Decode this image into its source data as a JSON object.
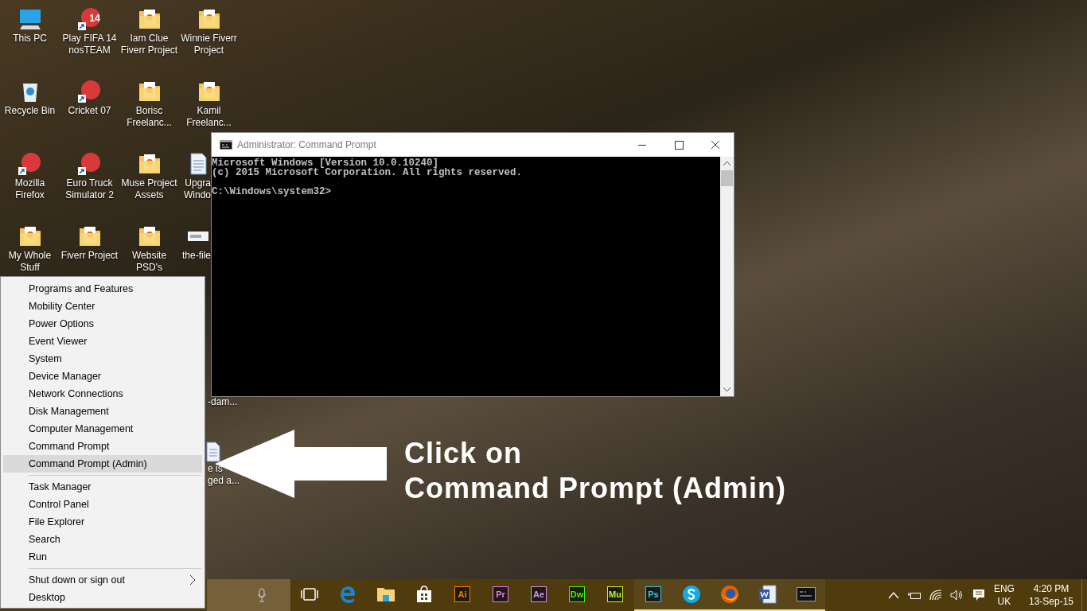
{
  "desktop_icons": [
    {
      "kind": "computer",
      "lines": [
        "This PC"
      ],
      "partial": false
    },
    {
      "kind": "recycle-bin",
      "lines": [
        "Recycle Bin"
      ],
      "partial": false
    },
    {
      "kind": "shortcut",
      "lines": [
        "Mozilla",
        "Firefox"
      ],
      "partial": false
    },
    {
      "kind": "folder",
      "lines": [
        "My Whole",
        "Stuff"
      ],
      "partial": false
    },
    {
      "kind": "shortcut",
      "badge": "14",
      "lines": [
        "Play FIFA 14",
        "nosTEAM"
      ],
      "partial": false
    },
    {
      "kind": "shortcut",
      "lines": [
        "Cricket 07"
      ],
      "partial": false
    },
    {
      "kind": "shortcut",
      "lines": [
        "Euro Truck",
        "Simulator 2"
      ],
      "partial": false
    },
    {
      "kind": "folder",
      "lines": [
        "Fiverr Project"
      ],
      "partial": false
    },
    {
      "kind": "folder",
      "lines": [
        "Iam Clue",
        "Fiverr Project"
      ],
      "partial": false
    },
    {
      "kind": "folder",
      "lines": [
        "Borisc",
        "Freelanc..."
      ],
      "partial": false
    },
    {
      "kind": "folder",
      "lines": [
        "Muse Project",
        "Assets"
      ],
      "partial": false
    },
    {
      "kind": "folder",
      "lines": [
        "Website",
        "PSD's"
      ],
      "partial": false
    },
    {
      "kind": "folder",
      "lines": [
        "Winnie Fiverr",
        "Project"
      ],
      "partial": false
    },
    {
      "kind": "folder",
      "lines": [
        "Kamil",
        "Freelanc..."
      ],
      "partial": false
    },
    {
      "kind": "document",
      "lines": [
        "Upgra",
        "Windo"
      ],
      "partial": true
    },
    {
      "kind": "image",
      "lines": [
        "the-file"
      ],
      "partial": true
    }
  ],
  "desktop_fragments": [
    {
      "kind": "none",
      "lines": [
        "-dam..."
      ]
    },
    {
      "kind": "document",
      "lines": [
        "e is",
        "ged a..."
      ]
    }
  ],
  "console": {
    "title": "Administrator: Command Prompt",
    "lines": [
      "Microsoft Windows [Version 10.0.10240]",
      "(c) 2015 Microsoft Corporation. All rights reserved."
    ],
    "prompt": "C:\\Windows\\system32>"
  },
  "context_menu": {
    "groups": [
      [
        {
          "label": "Programs and Features",
          "selected": false,
          "has_submenu": false
        },
        {
          "label": "Mobility Center",
          "selected": false,
          "has_submenu": false
        },
        {
          "label": "Power Options",
          "selected": false,
          "has_submenu": false
        },
        {
          "label": "Event Viewer",
          "selected": false,
          "has_submenu": false
        },
        {
          "label": "System",
          "selected": false,
          "has_submenu": false
        },
        {
          "label": "Device Manager",
          "selected": false,
          "has_submenu": false
        },
        {
          "label": "Network Connections",
          "selected": false,
          "has_submenu": false
        },
        {
          "label": "Disk Management",
          "selected": false,
          "has_submenu": false
        },
        {
          "label": "Computer Management",
          "selected": false,
          "has_submenu": false
        },
        {
          "label": "Command Prompt",
          "selected": false,
          "has_submenu": false
        },
        {
          "label": "Command Prompt (Admin)",
          "selected": true,
          "has_submenu": false
        }
      ],
      [
        {
          "label": "Task Manager",
          "selected": false,
          "has_submenu": false
        },
        {
          "label": "Control Panel",
          "selected": false,
          "has_submenu": false
        },
        {
          "label": "File Explorer",
          "selected": false,
          "has_submenu": false
        },
        {
          "label": "Search",
          "selected": false,
          "has_submenu": false
        },
        {
          "label": "Run",
          "selected": false,
          "has_submenu": false
        }
      ],
      [
        {
          "label": "Shut down or sign out",
          "selected": false,
          "has_submenu": true
        },
        {
          "label": "Desktop",
          "selected": false,
          "has_submenu": false
        }
      ]
    ]
  },
  "annotation": {
    "lines": [
      "Click on",
      "Command Prompt (Admin)"
    ]
  },
  "taskbar": {
    "apps": [
      {
        "kind": "task-view",
        "running": false
      },
      {
        "kind": "edge",
        "running": false
      },
      {
        "kind": "explorer",
        "running": false
      },
      {
        "kind": "store",
        "running": false
      },
      {
        "kind": "adobe",
        "label": "Ai",
        "color": "#ff7c00",
        "running": false
      },
      {
        "kind": "adobe",
        "label": "Pr",
        "color": "#e579ff",
        "running": false
      },
      {
        "kind": "adobe",
        "label": "Ae",
        "color": "#d291ff",
        "running": false
      },
      {
        "kind": "adobe",
        "label": "Dw",
        "color": "#35fa00",
        "running": false
      },
      {
        "kind": "adobe",
        "label": "Mu",
        "color": "#c2f42f",
        "running": false
      },
      {
        "kind": "adobe",
        "label": "Ps",
        "color": "#31c5f4",
        "running": true
      },
      {
        "kind": "skype",
        "running": true
      },
      {
        "kind": "firefox",
        "running": true
      },
      {
        "kind": "word",
        "running": true
      },
      {
        "kind": "console",
        "running": true
      }
    ],
    "language": [
      "ENG",
      "UK"
    ],
    "time": "4:20 PM",
    "date": "13-Sep-15"
  }
}
